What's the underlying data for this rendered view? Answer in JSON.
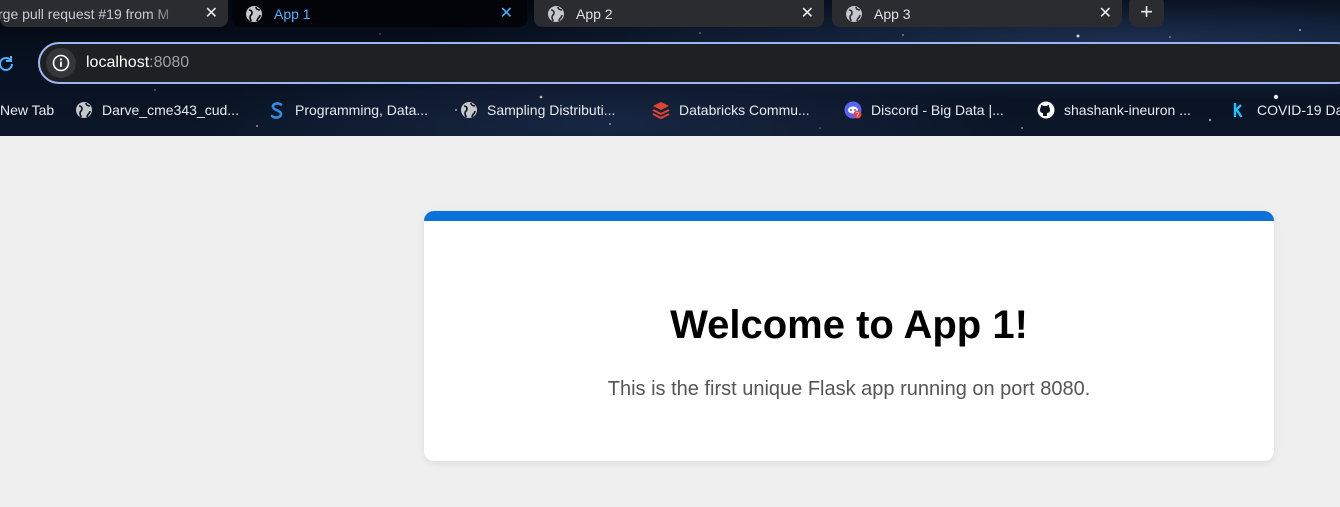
{
  "browser": {
    "tabs": [
      {
        "title": "rge pull request #19 from M",
        "icon": "page-icon",
        "active": false
      },
      {
        "title": "App 1",
        "icon": "globe-icon",
        "active": true
      },
      {
        "title": "App 2",
        "icon": "globe-icon",
        "active": false
      },
      {
        "title": "App 3",
        "icon": "globe-icon",
        "active": false
      }
    ],
    "close_glyph": "✕",
    "new_tab_glyph": "+",
    "address": {
      "host": "localhost",
      "port": ":8080"
    },
    "bookmarks": [
      {
        "label": "New Tab",
        "icon": "none"
      },
      {
        "label": "Darve_cme343_cud...",
        "icon": "globe-icon"
      },
      {
        "label": "Programming, Data...",
        "icon": "s-logo-icon"
      },
      {
        "label": "Sampling Distributi...",
        "icon": "globe-icon"
      },
      {
        "label": "Databricks Commu...",
        "icon": "databricks-icon"
      },
      {
        "label": "Discord - Big Data |...",
        "icon": "discord-icon"
      },
      {
        "label": "shashank-ineuron ...",
        "icon": "github-icon"
      },
      {
        "label": "COVID-19 Da",
        "icon": "kaggle-icon"
      }
    ]
  },
  "page": {
    "heading": "Welcome to App 1!",
    "subtitle": "This is the first unique Flask app running on port 8080.",
    "accent_color": "#0b72db"
  }
}
